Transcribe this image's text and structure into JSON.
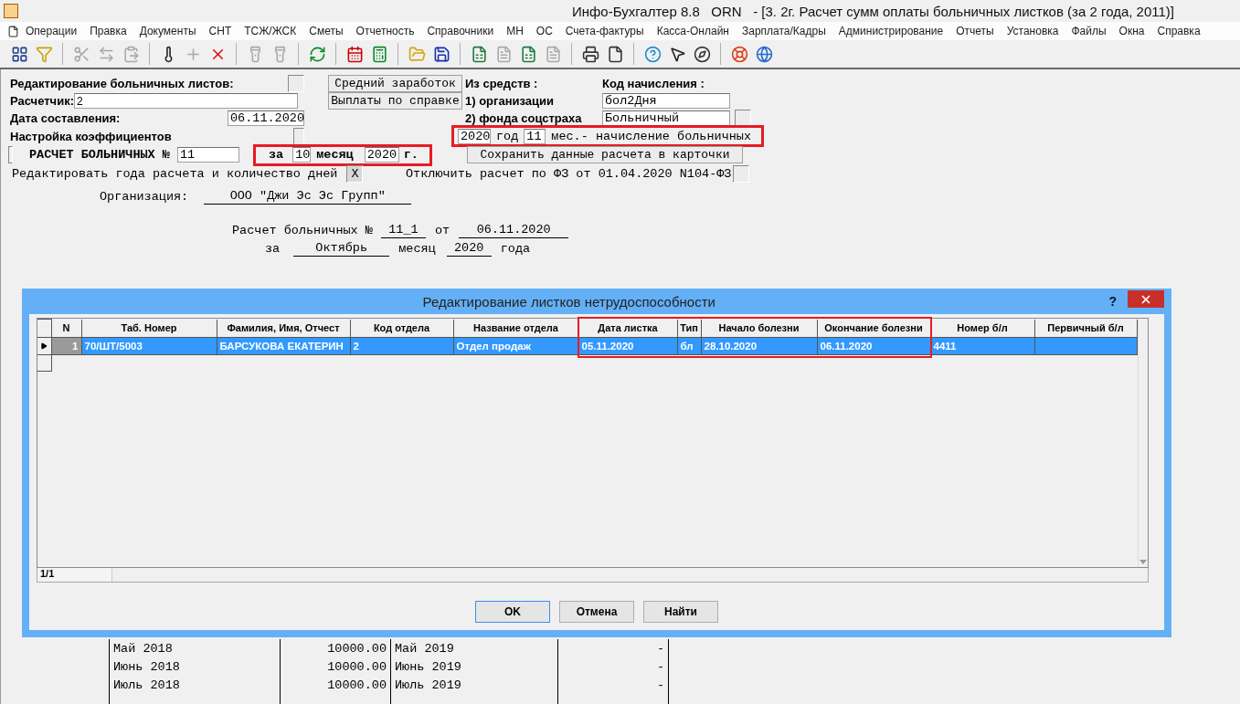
{
  "window": {
    "title": "Инфо-Бухгалтер 8.8   ORN   - [3. 2г. Расчет сумм оплаты больничных листков (за 2 года, 2011)]"
  },
  "menu": [
    "Операции",
    "Правка",
    "Документы",
    "СНТ",
    "ТСЖ/ЖСК",
    "Сметы",
    "Отчетность",
    "Справочники",
    "МН",
    "ОС",
    "Счета-фактуры",
    "Касса-Онлайн",
    "Зарплата/Кадры",
    "Администрирование",
    "Отчеты",
    "Установка",
    "Файлы",
    "Окна",
    "Справка"
  ],
  "toolbar": [
    [
      {
        "kind": "grid",
        "disabled": false
      },
      {
        "kind": "filter",
        "disabled": false
      }
    ],
    [
      {
        "kind": "scissors",
        "disabled": true
      },
      {
        "kind": "mirror",
        "disabled": true
      },
      {
        "kind": "paste",
        "disabled": true
      }
    ],
    [
      {
        "kind": "thermometer",
        "disabled": false
      },
      {
        "kind": "plus",
        "disabled": true
      },
      {
        "kind": "delete",
        "disabled": false
      }
    ],
    [
      {
        "kind": "flashlight",
        "disabled": true
      },
      {
        "kind": "flashlight",
        "disabled": true
      }
    ],
    [
      {
        "kind": "refresh",
        "disabled": false
      }
    ],
    [
      {
        "kind": "calendar",
        "disabled": false
      },
      {
        "kind": "calculator",
        "disabled": false
      }
    ],
    [
      {
        "kind": "open",
        "disabled": false
      },
      {
        "kind": "save",
        "disabled": false
      }
    ],
    [
      {
        "kind": "sheet",
        "disabled": false
      },
      {
        "kind": "doc",
        "disabled": true
      },
      {
        "kind": "sheet",
        "disabled": false
      },
      {
        "kind": "doc",
        "disabled": true
      }
    ],
    [
      {
        "kind": "print",
        "disabled": false
      },
      {
        "kind": "page",
        "disabled": false
      }
    ],
    [
      {
        "kind": "help",
        "disabled": false
      },
      {
        "kind": "pointer",
        "disabled": false
      },
      {
        "kind": "compass",
        "disabled": false
      }
    ],
    [
      {
        "kind": "lifebuoy",
        "disabled": false
      },
      {
        "kind": "globe",
        "disabled": false
      }
    ]
  ],
  "form": {
    "edit_sheets": {
      "label": "Редактирование больничных листов:",
      "checked": false
    },
    "calculator": {
      "label": "Расчетчик:",
      "value": "2"
    },
    "date": {
      "label": "Дата составления:",
      "value": "06.11.2020"
    },
    "coefficients": {
      "label": "Настройка коэффициентов",
      "checked": false
    },
    "buttons": [
      "Средний заработок",
      "Выплаты по справке"
    ],
    "sources": {
      "label": "Из средств :",
      "items": [
        "1) организации",
        "2) фонда соцстраха"
      ]
    },
    "accrual_code": {
      "label": "Код начисления :",
      "values": [
        "бол2Дня",
        "Больничный"
      ],
      "checked": false
    },
    "accrual": {
      "year": "2020",
      "year_label": "год",
      "month": "11",
      "text": "мес.- начисление больничных",
      "annotated": true
    },
    "calc_no": {
      "label": "РАСЧЕТ БОЛЬНИЧНЫХ №",
      "value": "11"
    },
    "period": {
      "prefix": "за",
      "month": "10",
      "month_label": "месяц",
      "year": "2020",
      "suffix": "г.",
      "annotated": true
    },
    "save_button": "Сохранить данные расчета в карточки",
    "edit_years": {
      "label": "Редактировать года расчета и количество дней",
      "checked": true,
      "mark": "X"
    },
    "disable_law": {
      "label": "Отключить расчет по ФЗ от 01.04.2020 N104-ФЗ",
      "checked": false
    },
    "organization": {
      "label": "Организация:",
      "value": "ООО \"Джи Эс Эс Групп\""
    },
    "header": {
      "title": "Расчет больничных №",
      "number": "11_1",
      "from": "от",
      "date": "06.11.2020",
      "for": "за",
      "month": "Октябрь",
      "month_label": "месяц",
      "year": "2020",
      "year_label": "года"
    }
  },
  "dialog": {
    "title": "Редактирование листков нетрудоспособности",
    "help": "?",
    "columns": [
      {
        "label": "N",
        "annotated": false
      },
      {
        "label": "Таб. Номер",
        "annotated": false
      },
      {
        "label": "Фамилия, Имя, Отчест",
        "annotated": false
      },
      {
        "label": "Код отдела",
        "annotated": false
      },
      {
        "label": "Название отдела",
        "annotated": false
      },
      {
        "label": "Дата листка",
        "annotated": true
      },
      {
        "label": "Тип",
        "annotated": true
      },
      {
        "label": "Начало болезни",
        "annotated": true
      },
      {
        "label": "Окончание болезни",
        "annotated": true
      },
      {
        "label": "Номер б/л",
        "annotated": false
      },
      {
        "label": "Первичный б/л",
        "annotated": false
      }
    ],
    "rows": [
      {
        "selected": true,
        "cells": [
          "1",
          "70/ШТ/5003",
          "БАРСУКОВА ЕКАТЕРИН",
          "2",
          "Отдел продаж",
          "05.11.2020",
          "бл",
          "28.10.2020",
          "06.11.2020",
          "4411"
        ]
      }
    ],
    "status": "1/1",
    "buttons": [
      {
        "label": "OK",
        "default": true
      },
      {
        "label": "Отмена",
        "default": false
      },
      {
        "label": "Найти",
        "default": false
      }
    ]
  },
  "earnings_table": {
    "rows": [
      [
        "Май 2018",
        "10000.00",
        "Май 2019",
        "-"
      ],
      [
        "Июнь 2018",
        "10000.00",
        "Июнь 2019",
        "-"
      ],
      [
        "Июль 2018",
        "10000.00",
        "Июль 2019",
        "-"
      ]
    ]
  }
}
